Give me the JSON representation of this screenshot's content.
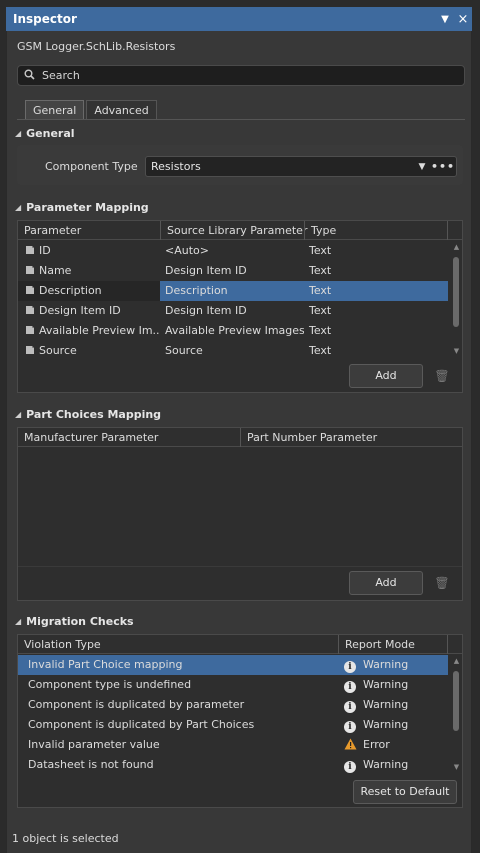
{
  "window": {
    "title": "Inspector",
    "pin_icon": "pin-dropdown-icon",
    "close_icon": "close-icon"
  },
  "object_name": "GSM Logger.SchLib.Resistors",
  "search": {
    "placeholder": "Search",
    "icon": "search-icon"
  },
  "tabs": [
    {
      "label": "General",
      "active": true
    },
    {
      "label": "Advanced",
      "active": false
    }
  ],
  "general": {
    "header": "General",
    "component_type_label": "Component Type",
    "component_type_value": "Resistors"
  },
  "parameter_mapping": {
    "header": "Parameter Mapping",
    "columns": [
      "Parameter",
      "Source Library Parameter",
      "Type"
    ],
    "rows": [
      {
        "parameter": "ID",
        "source": "<Auto>",
        "type": "Text",
        "selected": false
      },
      {
        "parameter": "Name",
        "source": "Design Item ID",
        "type": "Text",
        "selected": false
      },
      {
        "parameter": "Description",
        "source": "Description",
        "type": "Text",
        "selected": true
      },
      {
        "parameter": "Design Item ID",
        "source": "Design Item ID",
        "type": "Text",
        "selected": false
      },
      {
        "parameter": "Available Preview Im...",
        "source": "Available Preview Images",
        "type": "Text",
        "selected": false
      },
      {
        "parameter": "Source",
        "source": "Source",
        "type": "Text",
        "selected": false
      }
    ],
    "add_label": "Add"
  },
  "part_choices_mapping": {
    "header": "Part Choices Mapping",
    "columns": [
      "Manufacturer Parameter",
      "Part Number Parameter"
    ],
    "add_label": "Add"
  },
  "migration_checks": {
    "header": "Migration Checks",
    "columns": [
      "Violation Type",
      "Report Mode"
    ],
    "rows": [
      {
        "violation": "Invalid Part Choice mapping",
        "mode": "Warning",
        "icon": "info-icon",
        "selected": true
      },
      {
        "violation": "Component type is undefined",
        "mode": "Warning",
        "icon": "info-icon",
        "selected": false
      },
      {
        "violation": "Component is duplicated by parameter",
        "mode": "Warning",
        "icon": "info-icon",
        "selected": false
      },
      {
        "violation": "Component is duplicated by Part Choices",
        "mode": "Warning",
        "icon": "info-icon",
        "selected": false
      },
      {
        "violation": "Invalid parameter value",
        "mode": "Error",
        "icon": "warning-triangle-icon",
        "selected": false
      },
      {
        "violation": "Datasheet is not found",
        "mode": "Warning",
        "icon": "info-icon",
        "selected": false
      }
    ],
    "reset_label": "Reset to Default"
  },
  "status": "1 object is selected",
  "colors": {
    "accent": "#3e6a9e",
    "background": "#383838",
    "error_icon": "#e89a2c"
  }
}
